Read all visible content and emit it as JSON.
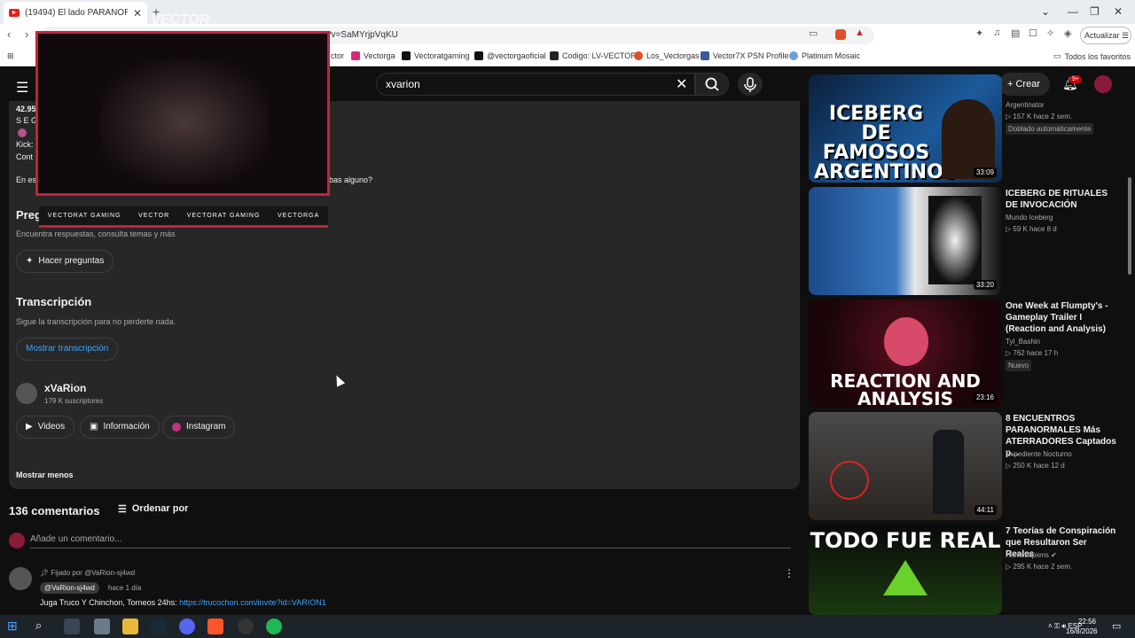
{
  "browser": {
    "tab_title": "(19494) El lado PARANORMAL d",
    "url": "?v=SaMYrjpVqKU",
    "update_label": "Actualizar",
    "bookmarks": [
      "ctor",
      "Vectorga",
      "Vectoratgaming",
      "@vectorgaoficial",
      "Codigo: LV-VECTOR",
      "Los_Vectorgas",
      "Vector7X PSN Profile",
      "Platinum Mosaic"
    ],
    "all_favorites": "Todos los favoritos"
  },
  "youtube": {
    "search_value": "xvarion",
    "create_label": "Crear",
    "notif_count": "9+"
  },
  "overlay": {
    "social": [
      "VECTORAT GAMING",
      "VECTOR",
      "VECTORAT GAMING",
      "VECTORGA"
    ]
  },
  "description": {
    "line1": "42.95",
    "line2": "S E G",
    "line3": "Kick:",
    "line4": "Cont",
    "line5a": "En es",
    "line5b": "bas alguno?",
    "questions_heading": "Preg",
    "questions_sub": "Encuentra respuestas, consulta temas y más",
    "ask_button": "Hacer preguntas",
    "transcript_heading": "Transcripción",
    "transcript_sub": "Sigue la transcripción para no perderte nada.",
    "transcript_button": "Mostrar transcripción",
    "channel_name": "xVaRion",
    "channel_subs": "179 K suscriptores",
    "videos_button": "Videos",
    "info_button": "Información",
    "instagram_button": "Instagram",
    "show_less": "Mostrar menos"
  },
  "comments": {
    "count": "136 comentarios",
    "sort_label": "Ordenar por",
    "add_placeholder": "Añade un comentario...",
    "pinned_by": "Fijado por @VaRion-sj4wd",
    "author": "@VaRion-sj4wd",
    "time": "hace 1 día",
    "text": "Juga Truco Y Chinchon, Torneos 24hs: ",
    "link": "https://trucochon.com/invite?id=VARION1"
  },
  "sidebar": [
    {
      "title": "",
      "channel": "Argentinator",
      "meta": "157 K  hace 2 sem.",
      "badge": "Doblado automáticamente",
      "duration": "33:09",
      "thumb_text": "ICEBERG DE FAMOSOS ARGENTINOS"
    },
    {
      "title": "ICEBERG DE RITUALES DE INVOCACIÓN",
      "channel": "Mundo Iceberg",
      "meta": "59 K  hace 8 d",
      "badge": "",
      "duration": "33:20",
      "thumb_text": ""
    },
    {
      "title": "One Week at Flumpty's - Gameplay Trailer I (Reaction and Analysis)",
      "channel": "Tyl_Bashin",
      "meta": "762  hace 17 h",
      "badge": "Nuevo",
      "duration": "23:16",
      "thumb_text": "REACTION AND ANALYSIS"
    },
    {
      "title": "8 ENCUENTROS PARANORMALES Más ATERRADORES Captados p...",
      "channel": "Expediente Nocturno",
      "meta": "250 K  hace 12 d",
      "badge": "",
      "duration": "44:11",
      "thumb_text": ""
    },
    {
      "title": "7 Teorías de Conspiración que Resultaron Ser Reales",
      "channel": "Homosapiens",
      "meta": "295 K  hace 2 sem.",
      "badge": "",
      "duration": "",
      "thumb_text": "TODO FUE REAL"
    }
  ],
  "taskbar": {
    "lang": "ESP",
    "time": "22:56",
    "date": "16/8/2026"
  }
}
